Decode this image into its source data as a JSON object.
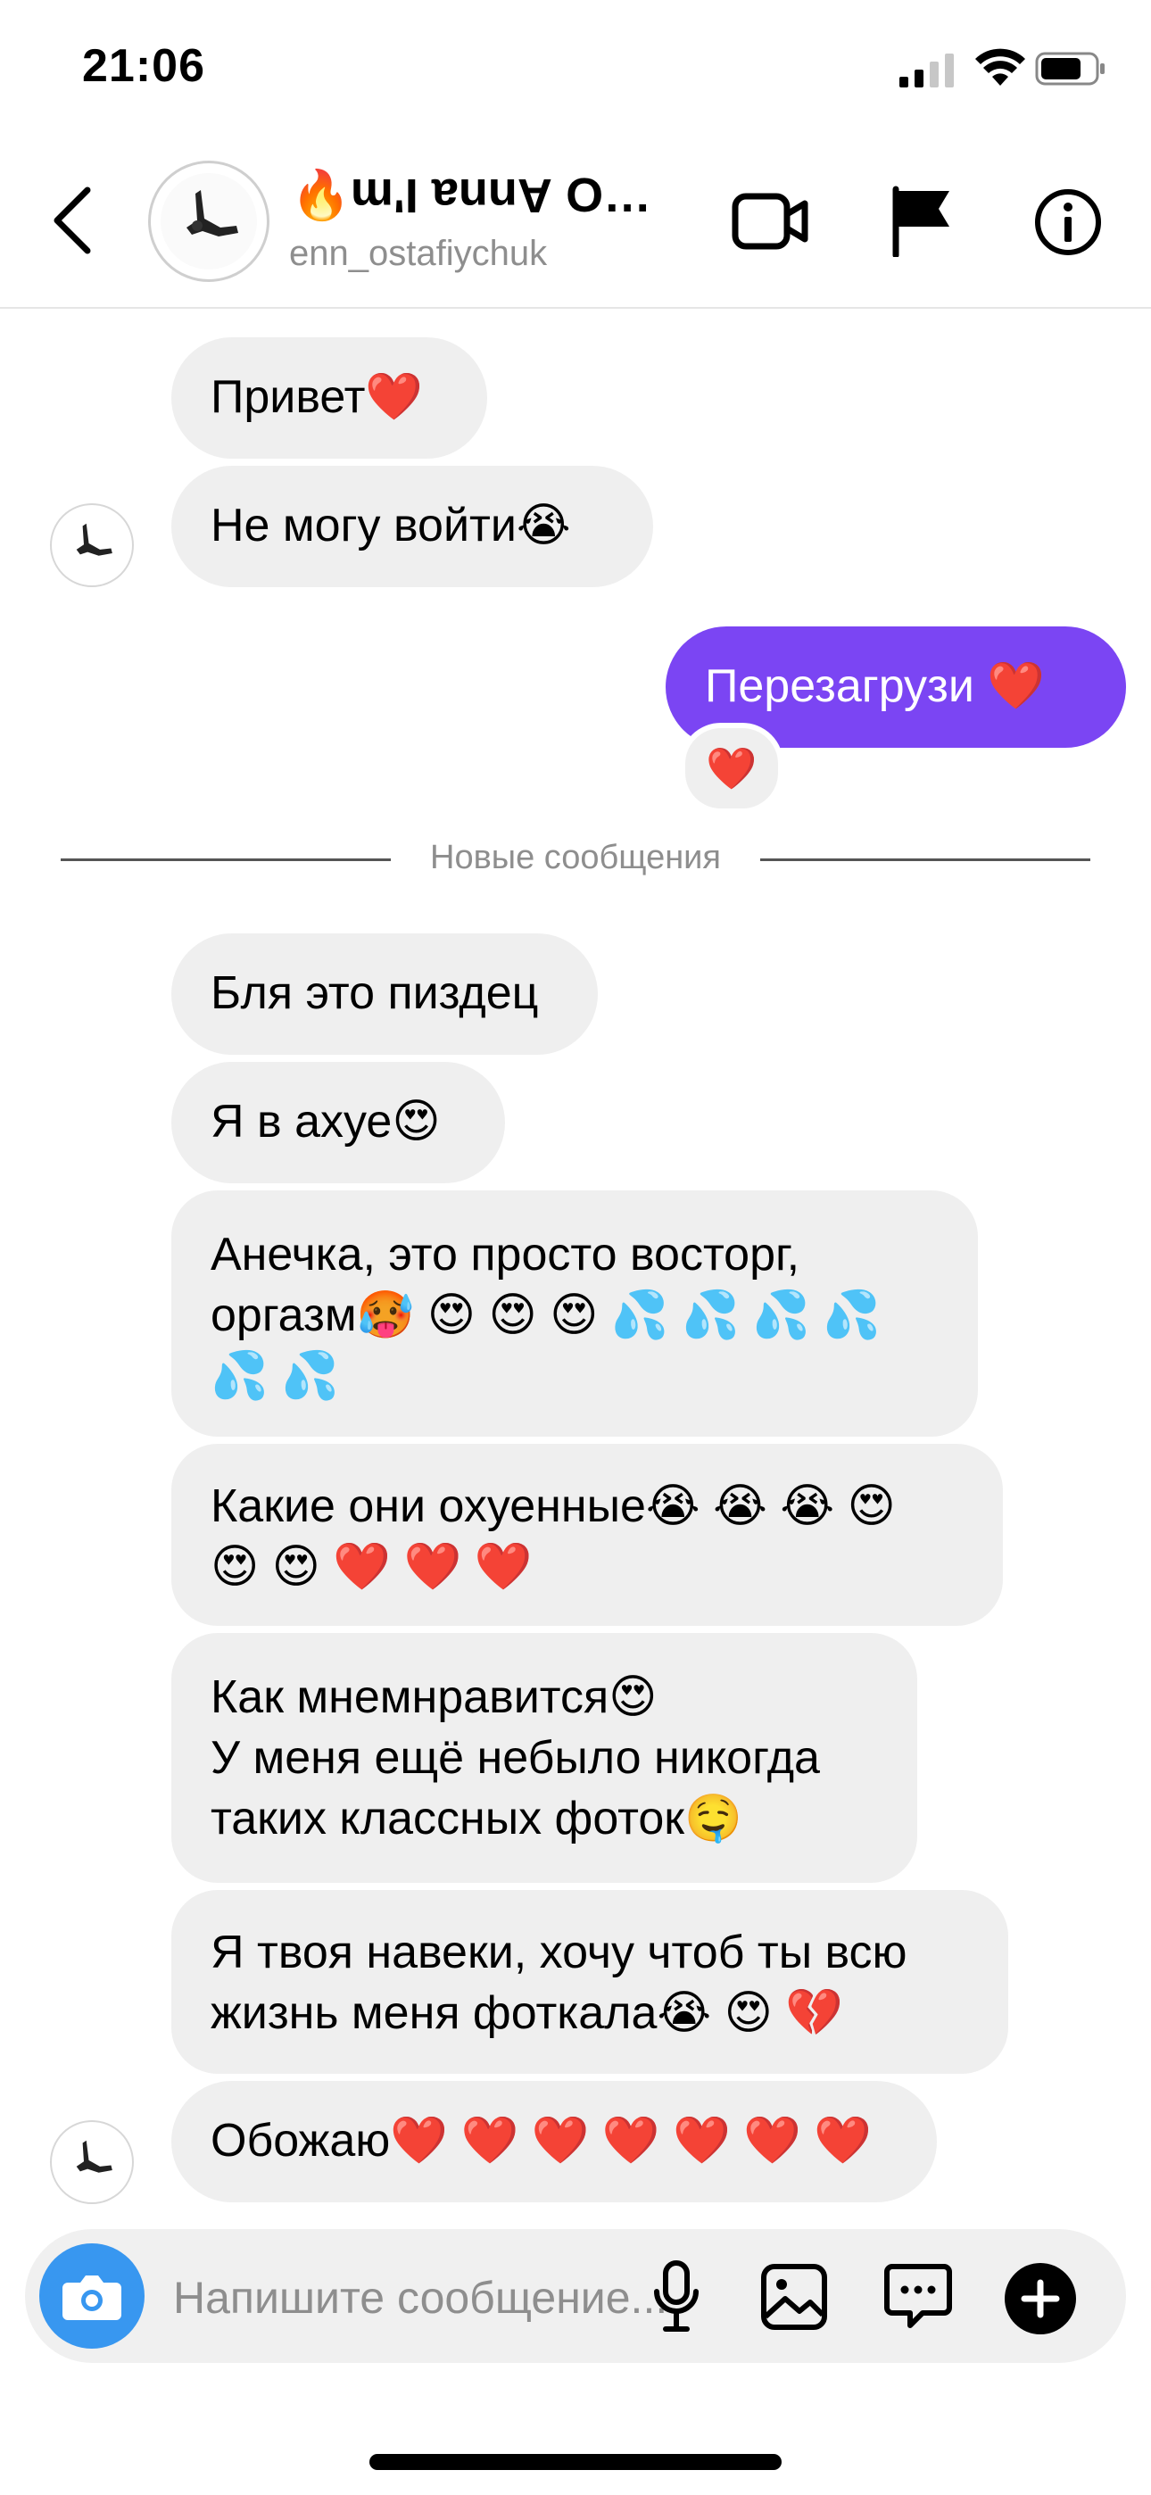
{
  "status_bar": {
    "time": "21:06"
  },
  "header": {
    "title_icon": "🔥",
    "title_flipped": "Anna I'm",
    "title_tail": "O…",
    "username": "enn_ostafiychuk"
  },
  "messages": [
    {
      "text": "Привет",
      "emoji": "❤️"
    },
    {
      "text": "Не могу войти",
      "emoji": "😭"
    },
    {
      "text": "Перезагрузи ",
      "emoji": "❤️",
      "mine": true,
      "reaction": "❤️"
    }
  ],
  "divider_label": "Новые сообщения",
  "new_messages": [
    {
      "lines": [
        "Бля это пиздец"
      ]
    },
    {
      "lines": [
        "Я в ахуе😍"
      ]
    },
    {
      "lines": [
        "Анечка, это просто восторг,",
        "оргазм🥵 😍 😍 😍 💦 💦 💦 💦",
        "💦 💦"
      ]
    },
    {
      "lines": [
        "Какие они охуенные😭 😭 😭 😍",
        "😍 😍 ❤️ ❤️ ❤️"
      ]
    },
    {
      "lines": [
        "Как мнемнравится😍",
        "У меня ещё небыло никогда",
        "таких классных фоток🤤"
      ]
    },
    {
      "lines": [
        "Я твоя навеки, хочу чтоб ты всю",
        "жизнь меня фоткала😭 😍 💔"
      ]
    },
    {
      "lines": [
        "Обожаю❤️ ❤️ ❤️ ❤️ ❤️ ❤️ ❤️"
      ]
    }
  ],
  "composer": {
    "placeholder": "Напишите сообщение..."
  },
  "colors": {
    "accent_bubble": "#7b45f3",
    "camera_button": "#3897f0",
    "bubble_gray": "#efefef"
  }
}
